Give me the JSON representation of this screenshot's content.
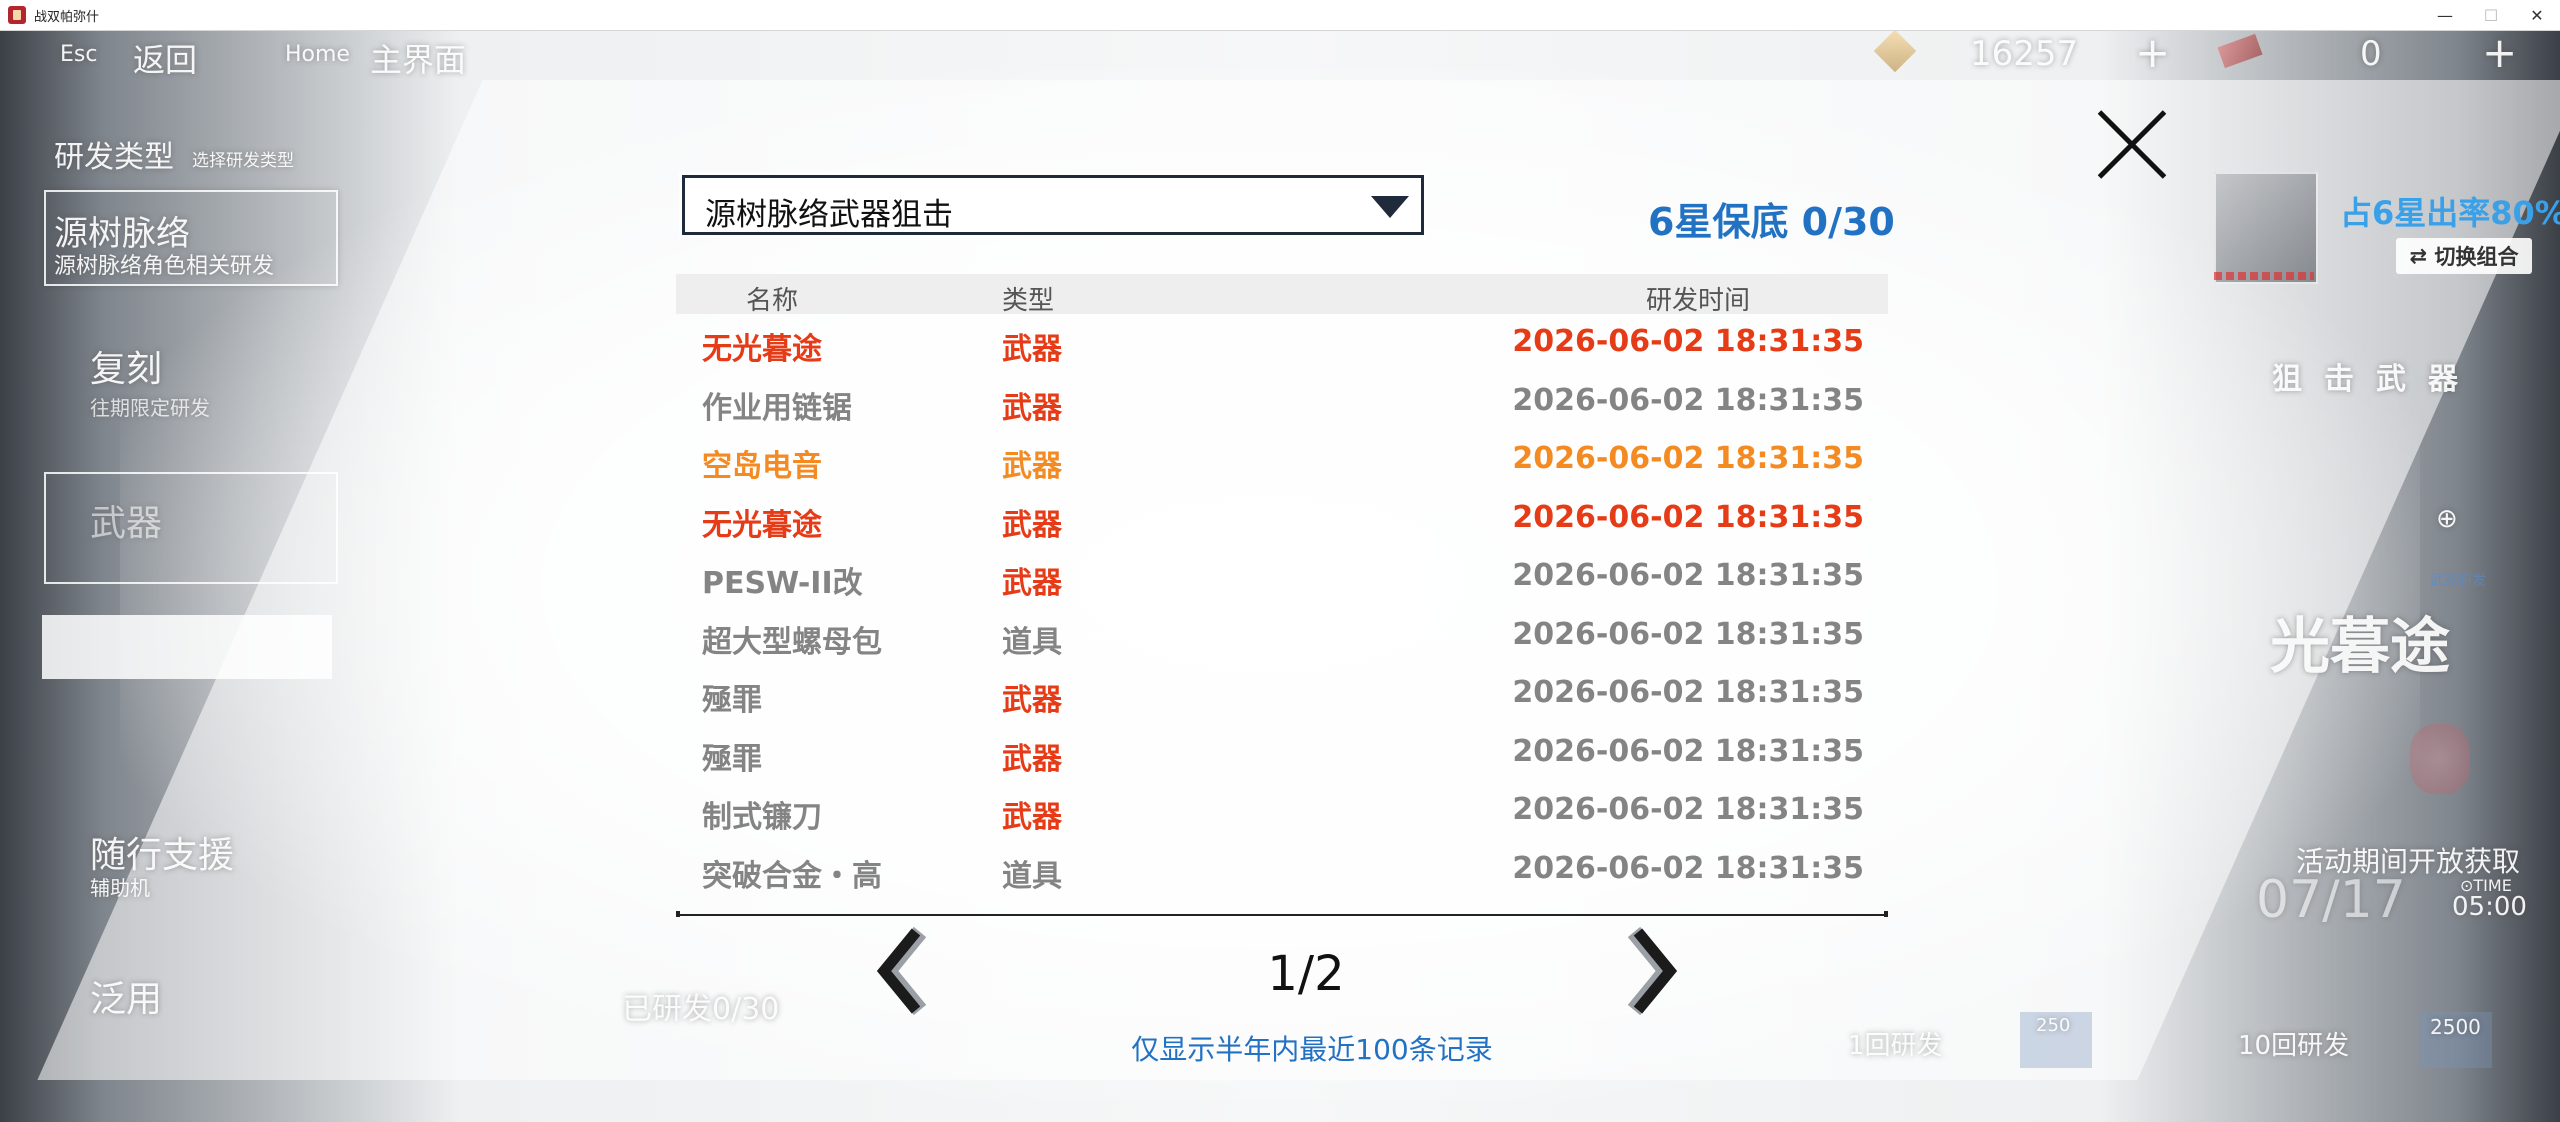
{
  "window": {
    "title": "战双帕弥什",
    "controls": [
      "—",
      "☐",
      "✕"
    ]
  },
  "nav": {
    "esc_key": "Esc",
    "back_label": "返回",
    "home_key": "Home",
    "main_label": "主界面"
  },
  "currency": {
    "primary": "16257",
    "secondary": "0",
    "add": "+"
  },
  "left_menu": {
    "category": "研发类型",
    "category_sub": "选择研发类型",
    "item1": "源树脉络",
    "item1_sub": "源树脉络角色相关研发",
    "item2": "复刻",
    "item2_sub": "往期限定研发",
    "item3": "武器",
    "item4": "随行支援",
    "item4_sub": "辅助机",
    "item5": "泛用"
  },
  "bottom_bg": {
    "developed": "已研发0/30",
    "draw_once": "1回研发",
    "draw_ten": "10回研发",
    "cost_once": "250",
    "cost_ten": "2500"
  },
  "right_bg": {
    "rate": "占6星出率80%",
    "switch": "切换组合",
    "snipe": "狙击武器",
    "small_tag": "武器研发",
    "weapon_name": "光暮途",
    "open": "活动期间开放获取",
    "date": "07/17",
    "time_label": "⊙TIME",
    "time": "05:00"
  },
  "history": {
    "dropdown_value": "源树脉络武器狙击",
    "pity": "6星保底 0/30",
    "columns": {
      "name": "名称",
      "type": "类型",
      "time": "研发时间"
    },
    "rows": [
      {
        "name": "无光暮途",
        "type": "武器",
        "time": "2026-06-02 18:31:35",
        "quality": "red"
      },
      {
        "name": "作业用链锯",
        "type": "武器",
        "time": "2026-06-02 18:31:35",
        "quality": "gray"
      },
      {
        "name": "空岛电音",
        "type": "武器",
        "time": "2026-06-02 18:31:35",
        "quality": "orange"
      },
      {
        "name": "无光暮途",
        "type": "武器",
        "time": "2026-06-02 18:31:35",
        "quality": "red"
      },
      {
        "name": "PESW-II改",
        "type": "武器",
        "time": "2026-06-02 18:31:35",
        "quality": "gray"
      },
      {
        "name": "超大型螺母包",
        "type": "道具",
        "time": "2026-06-02 18:31:35",
        "quality": "gray"
      },
      {
        "name": "殛罪",
        "type": "武器",
        "time": "2026-06-02 18:31:35",
        "quality": "gray"
      },
      {
        "name": "殛罪",
        "type": "武器",
        "time": "2026-06-02 18:31:35",
        "quality": "gray"
      },
      {
        "name": "制式镰刀",
        "type": "武器",
        "time": "2026-06-02 18:31:35",
        "quality": "gray"
      },
      {
        "name": "突破合金・高",
        "type": "道具",
        "time": "2026-06-02 18:31:35",
        "quality": "gray"
      }
    ],
    "page": "1/2",
    "note": "仅显示半年内最近100条记录"
  },
  "colors": {
    "accent_blue": "#2272c4",
    "quality_red": "#e53b17",
    "quality_orange": "#f38a22",
    "quality_gray": "#848484"
  },
  "icons": {
    "close": "close-icon",
    "prev": "chevron-left-icon",
    "next": "chevron-right-icon",
    "dropdown": "caret-down-icon",
    "switch": "swap-icon"
  }
}
